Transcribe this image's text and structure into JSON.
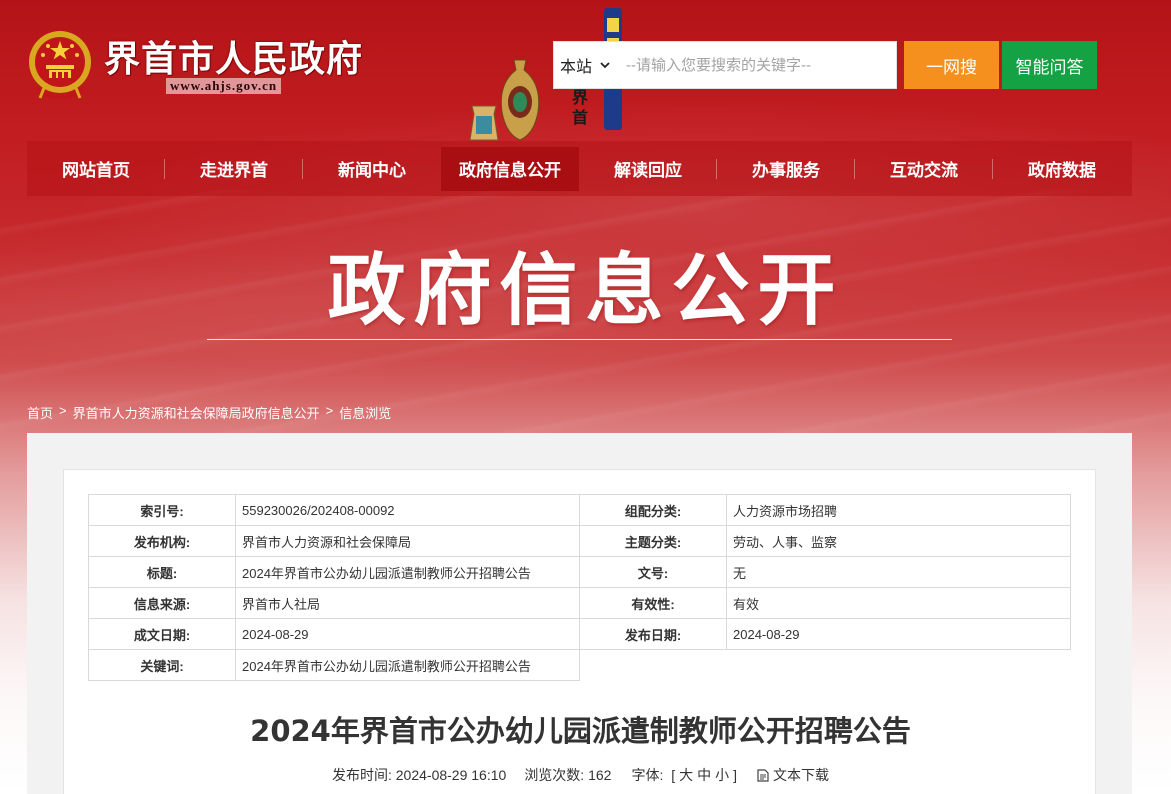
{
  "header": {
    "site_name": "界首市人民政府",
    "site_url": "www.ahjs.gov.cn",
    "deco_text": "界首",
    "search": {
      "scope": "本站",
      "placeholder": "--请输入您要搜索的关键字--",
      "value": "",
      "search_label": "一网搜",
      "ai_label": "智能问答"
    }
  },
  "nav": {
    "items": [
      "网站首页",
      "走进界首",
      "新闻中心",
      "政府信息公开",
      "解读回应",
      "办事服务",
      "互动交流",
      "政府数据"
    ],
    "active": "政府信息公开"
  },
  "hero": {
    "title": "政府信息公开"
  },
  "breadcrumb": {
    "items": [
      "首页",
      "界首市人力资源和社会保障局政府信息公开",
      "信息浏览"
    ],
    "separator": ">"
  },
  "meta_table": {
    "index_label": "索引号:",
    "index_value": "559230026/202408-00092",
    "group_label": "组配分类:",
    "group_value": "人力资源市场招聘",
    "org_label": "发布机构:",
    "org_value": "界首市人力资源和社会保障局",
    "topic_label": "主题分类:",
    "topic_value": "劳动、人事、监察",
    "title_label": "标题:",
    "title_value": "2024年界首市公办幼儿园派遣制教师公开招聘公告",
    "docno_label": "文号:",
    "docno_value": "无",
    "source_label": "信息来源:",
    "source_value": "界首市人社局",
    "valid_label": "有效性:",
    "valid_value": "有效",
    "created_label": "成文日期:",
    "created_value": "2024-08-29",
    "published_label": "发布日期:",
    "published_value": "2024-08-29",
    "keywords_label": "关键词:",
    "keywords_value": "2024年界首市公办幼儿园派遣制教师公开招聘公告"
  },
  "article": {
    "title": "2024年界首市公办幼儿园派遣制教师公开招聘公告",
    "publish_time_label": "发布时间:",
    "publish_time": "2024-08-29 16:10",
    "views_label": "浏览次数:",
    "views": "162",
    "font_label": "字体:",
    "font_open": "[",
    "font_large": "大",
    "font_medium": "中",
    "font_small": "小",
    "font_close": "]",
    "download_label": "文本下载"
  },
  "colors": {
    "brand_red": "#b41417",
    "search_orange": "#f5901e",
    "ai_green": "#14a244",
    "nav_active": "#a90e13"
  },
  "icons": [
    "national-emblem-icon",
    "chevron-down-icon",
    "document-icon"
  ]
}
